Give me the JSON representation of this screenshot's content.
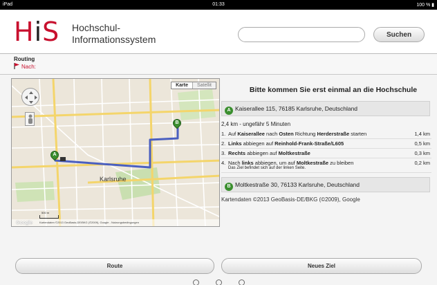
{
  "statusbar": {
    "device": "iPad",
    "time": "01:33",
    "battery": "100 %"
  },
  "header": {
    "logo": "HiS",
    "title_line1": "Hochschul-",
    "title_line2": "Informationssystem",
    "search_value": "",
    "search_button": "Suchen"
  },
  "routing": {
    "title": "Routing",
    "nach_label": "Nach:"
  },
  "map": {
    "type_karte": "Karte",
    "type_satellit": "Satellit",
    "city_label": "Karlsruhe",
    "attribution": "Kartendaten ©2013 GeoBasis-DE/BKG (©2009), Google - Nutzungsbedingungen",
    "google": "Google",
    "marker_a": "A",
    "marker_b": "B",
    "scale": "500 m",
    "route_color": "#4a5fc0"
  },
  "directions": {
    "title": "Bitte kommen Sie erst einmal an die Hochschule",
    "start_badge": "A",
    "start_address": "Kaiserallee 115, 76185 Karlsruhe, Deutschland",
    "summary": "2,4 km - ungefähr 5 Minuten",
    "steps": [
      {
        "num": "1.",
        "text": "Auf Kaiserallee nach Osten Richtung Herderstraße starten",
        "dist": "1,4 km"
      },
      {
        "num": "2.",
        "text": "Links abbiegen auf Reinhold-Frank-Straße/L605",
        "dist": "0,5 km"
      },
      {
        "num": "3.",
        "text": "Rechts abbiegen auf Moltkestraße",
        "dist": "0,3 km"
      },
      {
        "num": "4.",
        "text": "Nach links abbiegen, um auf Moltkestraße zu bleiben",
        "sub": "Das Ziel befindet sich auf der linken Seite.",
        "dist": "0,2 km"
      }
    ],
    "end_badge": "B",
    "end_address": "Moltkestraße 30, 76133 Karlsruhe, Deutschland",
    "copyright": "Kartendaten ©2013 GeoBasis-DE/BKG (©2009), Google"
  },
  "buttons": {
    "route": "Route",
    "neues_ziel": "Neues Ziel"
  },
  "colors": {
    "brand_red": "#c8102e",
    "marker_green": "#3b8f2f"
  }
}
